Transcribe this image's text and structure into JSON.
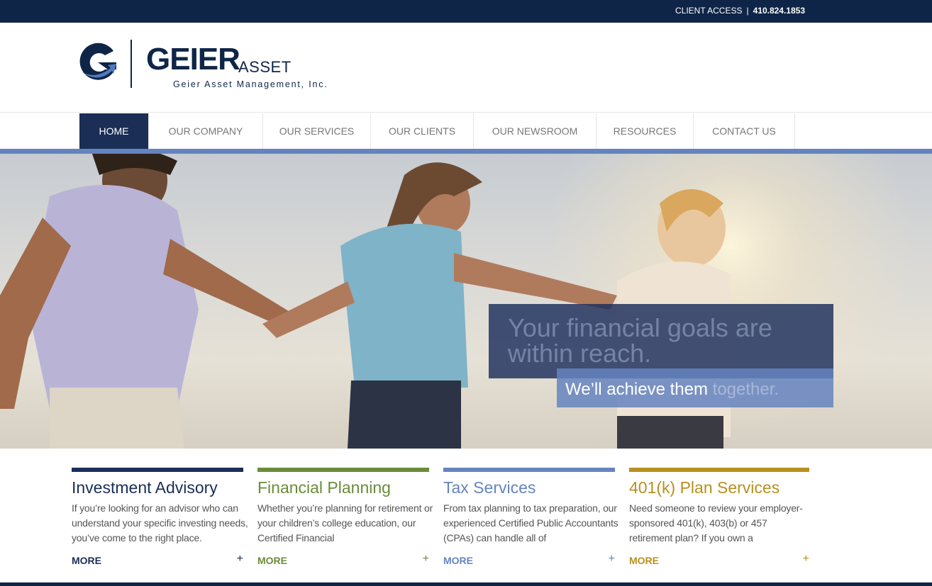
{
  "topbar": {
    "client_access": "CLIENT ACCESS",
    "separator": "|",
    "phone": "410.824.1853"
  },
  "logo": {
    "name": "GEIER",
    "asset": "ASSET",
    "subtitle": "Geier Asset Management, Inc."
  },
  "nav": {
    "items": [
      {
        "label": "HOME",
        "active": true
      },
      {
        "label": "OUR COMPANY"
      },
      {
        "label": "OUR SERVICES"
      },
      {
        "label": "OUR CLIENTS"
      },
      {
        "label": "OUR NEWSROOM"
      },
      {
        "label": "RESOURCES"
      },
      {
        "label": "CONTACT US"
      }
    ]
  },
  "hero": {
    "headline": "Your financial goals are within reach.",
    "sub_main": "We’ll achieve them",
    "sub_fade": " together."
  },
  "services": [
    {
      "title": "Investment Advisory",
      "text": "If you’re looking for an advisor who can understand your specific investing needs, you’ve come to the right place.",
      "more": "MORE",
      "plus": "+",
      "color": "#1a2e56"
    },
    {
      "title": "Financial Planning",
      "text": "Whether you’re planning for retirement or your children’s college education, our Certified Financial",
      "more": "MORE",
      "plus": "+",
      "color": "#6a8c3a"
    },
    {
      "title": "Tax Services",
      "text": "From tax planning to tax preparation, our experienced Certified Public Accountants (CPAs) can handle all of",
      "more": "MORE",
      "plus": "+",
      "color": "#6584bf"
    },
    {
      "title": "401(k) Plan Services",
      "text": "Need someone to review your employer-sponsored 401(k), 403(b) or 457 retirement plan? If you own a",
      "more": "MORE",
      "plus": "+",
      "color": "#b8901f"
    }
  ]
}
